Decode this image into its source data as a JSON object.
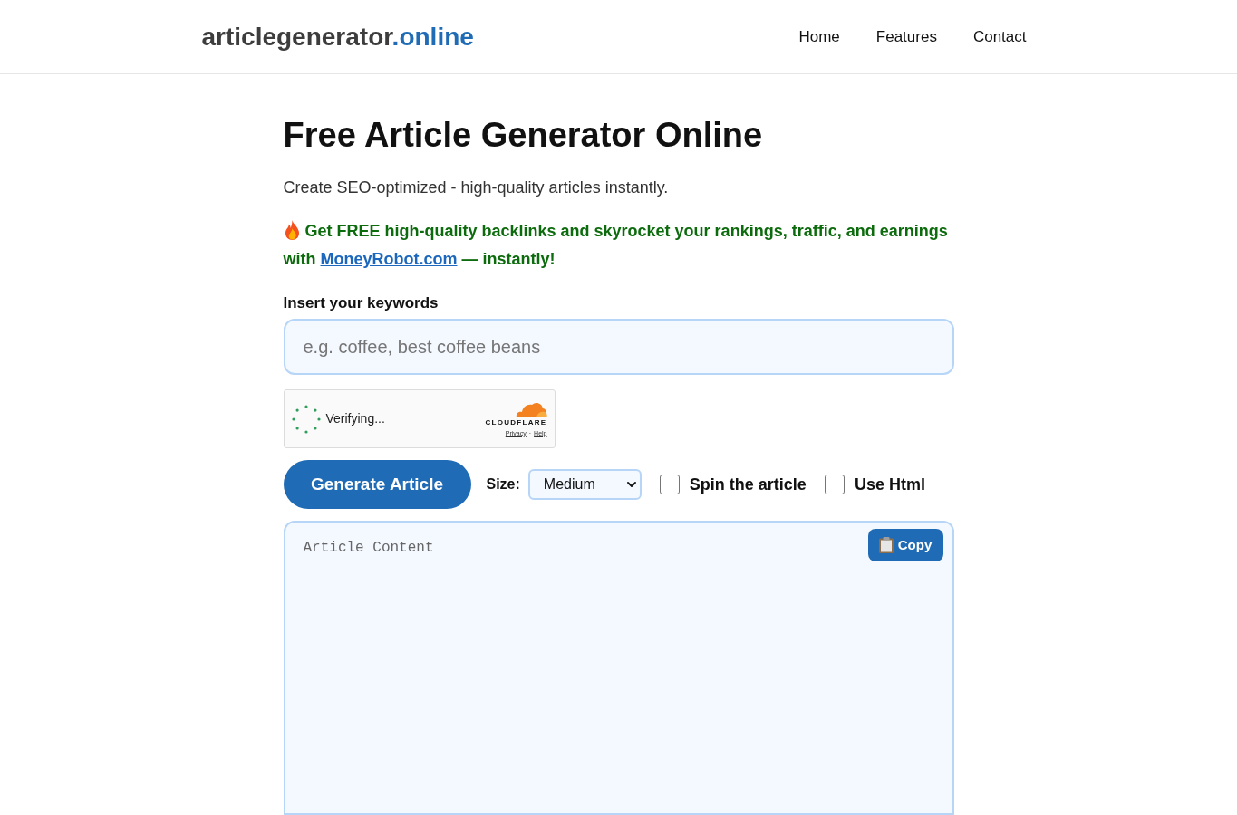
{
  "header": {
    "logo": {
      "text": "articlegenerator",
      "accent": ".online"
    },
    "nav": [
      "Home",
      "Features",
      "Contact"
    ]
  },
  "title": "Free Article Generator Online",
  "subtitle": "Create SEO-optimized - high-quality articles instantly.",
  "promo": {
    "before": "Get FREE high-quality backlinks and skyrocket your rankings, traffic, and earnings with",
    "link": "MoneyRobot.com",
    "after": "— instantly!"
  },
  "keywords": {
    "label": "Insert your keywords",
    "placeholder": "e.g. coffee, best coffee beans"
  },
  "captcha": {
    "status": "Verifying...",
    "brand": "CLOUDFLARE",
    "links": [
      "Privacy",
      "Help"
    ],
    "separator": "·"
  },
  "controls": {
    "generate_button": "Generate Article",
    "size": {
      "label": "Size:",
      "value": "Medium"
    },
    "options": [
      {
        "label": "Spin the article",
        "checked": false
      },
      {
        "label": "Use Html",
        "checked": false
      }
    ]
  },
  "article": {
    "placeholder": "Article Content",
    "copy_button": "Copy"
  }
}
